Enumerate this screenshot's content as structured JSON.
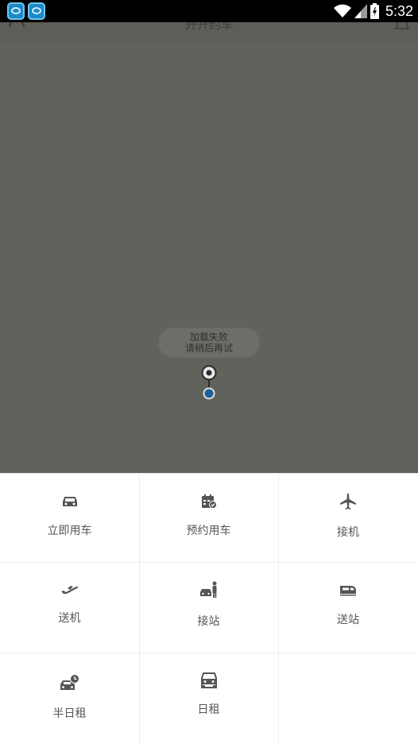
{
  "status_bar": {
    "time": "5:32"
  },
  "app_bar": {
    "title": "开开约车"
  },
  "map": {
    "toast_line1": "加载失败",
    "toast_line2": "请稍后再试"
  },
  "menu": {
    "items": [
      {
        "label": "立即用车",
        "icon": "car-front-icon"
      },
      {
        "label": "预约用车",
        "icon": "calendar-check-icon"
      },
      {
        "label": "接机",
        "icon": "airplane-icon"
      },
      {
        "label": "送机",
        "icon": "airplane-takeoff-icon"
      },
      {
        "label": "接站",
        "icon": "car-person-icon"
      },
      {
        "label": "送站",
        "icon": "train-icon"
      },
      {
        "label": "半日租",
        "icon": "car-clock-icon"
      },
      {
        "label": "日租",
        "icon": "car-double-icon"
      }
    ]
  },
  "colors": {
    "map_overlay": "#62625d",
    "icon": "#555555"
  }
}
